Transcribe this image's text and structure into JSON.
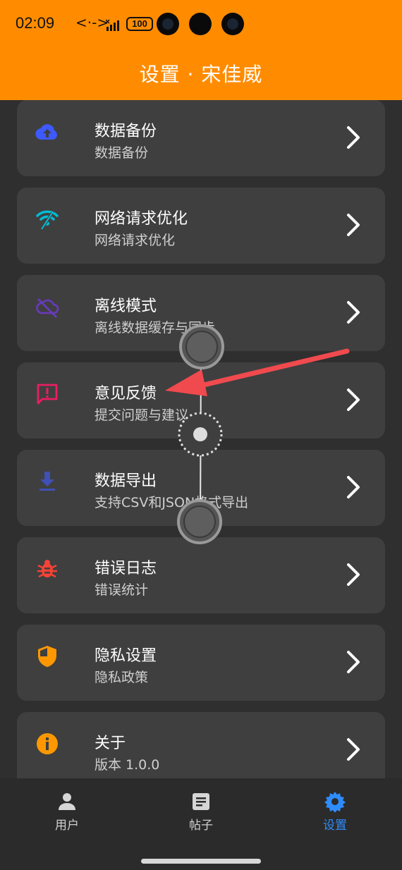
{
  "status_bar": {
    "time": "02:09",
    "code_icon_text": "<·->",
    "battery": "100"
  },
  "header": {
    "title": "设置 · 宋佳威"
  },
  "settings": [
    {
      "title": "数据备份",
      "subtitle": "数据备份",
      "icon": "cloud-upload-icon",
      "color": "#3d5afe"
    },
    {
      "title": "网络请求优化",
      "subtitle": "网络请求优化",
      "icon": "wifi-icon",
      "color": "#00bcd4"
    },
    {
      "title": "离线模式",
      "subtitle": "离线数据缓存与同步",
      "icon": "cloud-off-icon",
      "color": "#673ab7"
    },
    {
      "title": "意见反馈",
      "subtitle": "提交问题与建议",
      "icon": "feedback-icon",
      "color": "#e91e63"
    },
    {
      "title": "数据导出",
      "subtitle": "支持CSV和JSON格式导出",
      "icon": "download-icon",
      "color": "#3f51b5"
    },
    {
      "title": "错误日志",
      "subtitle": "错误统计",
      "icon": "bug-icon",
      "color": "#f44336"
    },
    {
      "title": "隐私设置",
      "subtitle": "隐私政策",
      "icon": "shield-icon",
      "color": "#ff9800"
    },
    {
      "title": "关于",
      "subtitle": "版本 1.0.0",
      "icon": "info-icon",
      "color": "#ff9800"
    }
  ],
  "bottom_nav": [
    {
      "label": "用户",
      "icon": "person-icon",
      "active": false
    },
    {
      "label": "帖子",
      "icon": "article-icon",
      "active": false
    },
    {
      "label": "设置",
      "icon": "gear-icon",
      "active": true
    }
  ],
  "colors": {
    "header": "#ff8c00",
    "background": "#2f2f2f",
    "card": "#3f3f3f",
    "nav_active": "#2f8cff",
    "annotation_arrow": "#f04a4f"
  }
}
